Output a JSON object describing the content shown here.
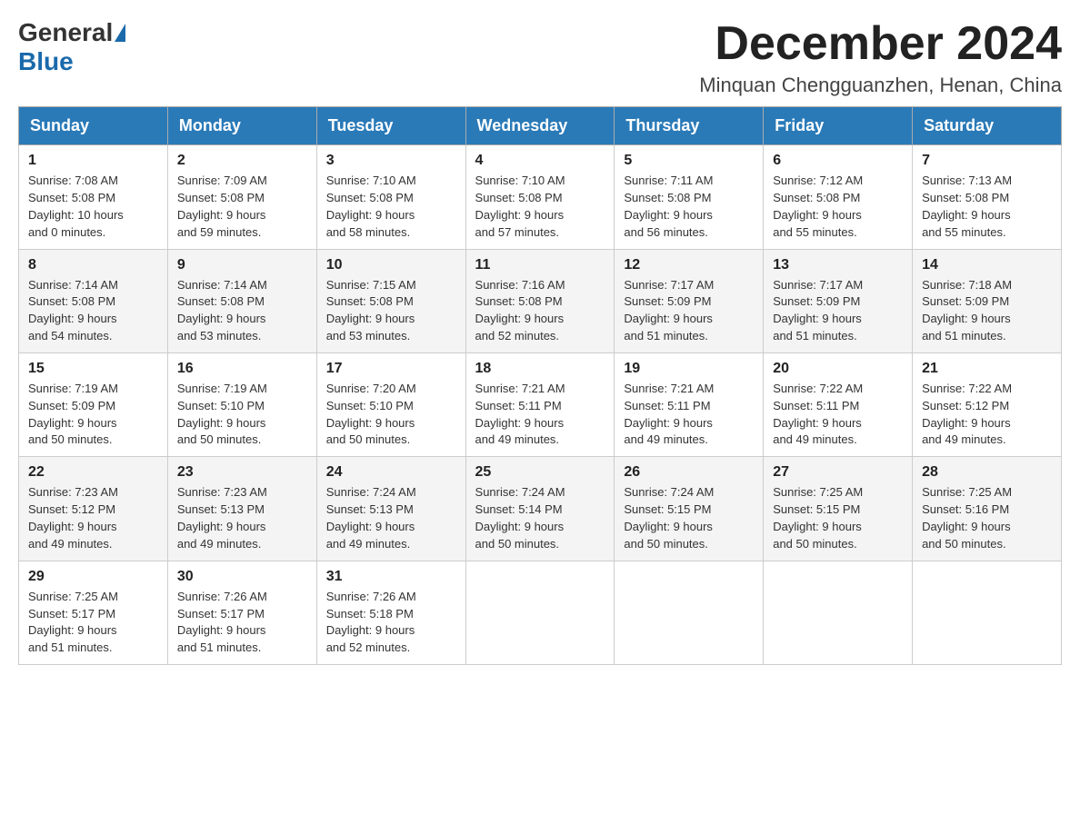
{
  "logo": {
    "general": "General",
    "blue": "Blue"
  },
  "header": {
    "month_year": "December 2024",
    "location": "Minquan Chengguanzhen, Henan, China"
  },
  "weekdays": [
    "Sunday",
    "Monday",
    "Tuesday",
    "Wednesday",
    "Thursday",
    "Friday",
    "Saturday"
  ],
  "weeks": [
    [
      {
        "day": "1",
        "sunrise": "7:08 AM",
        "sunset": "5:08 PM",
        "daylight": "10 hours and 0 minutes."
      },
      {
        "day": "2",
        "sunrise": "7:09 AM",
        "sunset": "5:08 PM",
        "daylight": "9 hours and 59 minutes."
      },
      {
        "day": "3",
        "sunrise": "7:10 AM",
        "sunset": "5:08 PM",
        "daylight": "9 hours and 58 minutes."
      },
      {
        "day": "4",
        "sunrise": "7:10 AM",
        "sunset": "5:08 PM",
        "daylight": "9 hours and 57 minutes."
      },
      {
        "day": "5",
        "sunrise": "7:11 AM",
        "sunset": "5:08 PM",
        "daylight": "9 hours and 56 minutes."
      },
      {
        "day": "6",
        "sunrise": "7:12 AM",
        "sunset": "5:08 PM",
        "daylight": "9 hours and 55 minutes."
      },
      {
        "day": "7",
        "sunrise": "7:13 AM",
        "sunset": "5:08 PM",
        "daylight": "9 hours and 55 minutes."
      }
    ],
    [
      {
        "day": "8",
        "sunrise": "7:14 AM",
        "sunset": "5:08 PM",
        "daylight": "9 hours and 54 minutes."
      },
      {
        "day": "9",
        "sunrise": "7:14 AM",
        "sunset": "5:08 PM",
        "daylight": "9 hours and 53 minutes."
      },
      {
        "day": "10",
        "sunrise": "7:15 AM",
        "sunset": "5:08 PM",
        "daylight": "9 hours and 53 minutes."
      },
      {
        "day": "11",
        "sunrise": "7:16 AM",
        "sunset": "5:08 PM",
        "daylight": "9 hours and 52 minutes."
      },
      {
        "day": "12",
        "sunrise": "7:17 AM",
        "sunset": "5:09 PM",
        "daylight": "9 hours and 51 minutes."
      },
      {
        "day": "13",
        "sunrise": "7:17 AM",
        "sunset": "5:09 PM",
        "daylight": "9 hours and 51 minutes."
      },
      {
        "day": "14",
        "sunrise": "7:18 AM",
        "sunset": "5:09 PM",
        "daylight": "9 hours and 51 minutes."
      }
    ],
    [
      {
        "day": "15",
        "sunrise": "7:19 AM",
        "sunset": "5:09 PM",
        "daylight": "9 hours and 50 minutes."
      },
      {
        "day": "16",
        "sunrise": "7:19 AM",
        "sunset": "5:10 PM",
        "daylight": "9 hours and 50 minutes."
      },
      {
        "day": "17",
        "sunrise": "7:20 AM",
        "sunset": "5:10 PM",
        "daylight": "9 hours and 50 minutes."
      },
      {
        "day": "18",
        "sunrise": "7:21 AM",
        "sunset": "5:11 PM",
        "daylight": "9 hours and 49 minutes."
      },
      {
        "day": "19",
        "sunrise": "7:21 AM",
        "sunset": "5:11 PM",
        "daylight": "9 hours and 49 minutes."
      },
      {
        "day": "20",
        "sunrise": "7:22 AM",
        "sunset": "5:11 PM",
        "daylight": "9 hours and 49 minutes."
      },
      {
        "day": "21",
        "sunrise": "7:22 AM",
        "sunset": "5:12 PM",
        "daylight": "9 hours and 49 minutes."
      }
    ],
    [
      {
        "day": "22",
        "sunrise": "7:23 AM",
        "sunset": "5:12 PM",
        "daylight": "9 hours and 49 minutes."
      },
      {
        "day": "23",
        "sunrise": "7:23 AM",
        "sunset": "5:13 PM",
        "daylight": "9 hours and 49 minutes."
      },
      {
        "day": "24",
        "sunrise": "7:24 AM",
        "sunset": "5:13 PM",
        "daylight": "9 hours and 49 minutes."
      },
      {
        "day": "25",
        "sunrise": "7:24 AM",
        "sunset": "5:14 PM",
        "daylight": "9 hours and 50 minutes."
      },
      {
        "day": "26",
        "sunrise": "7:24 AM",
        "sunset": "5:15 PM",
        "daylight": "9 hours and 50 minutes."
      },
      {
        "day": "27",
        "sunrise": "7:25 AM",
        "sunset": "5:15 PM",
        "daylight": "9 hours and 50 minutes."
      },
      {
        "day": "28",
        "sunrise": "7:25 AM",
        "sunset": "5:16 PM",
        "daylight": "9 hours and 50 minutes."
      }
    ],
    [
      {
        "day": "29",
        "sunrise": "7:25 AM",
        "sunset": "5:17 PM",
        "daylight": "9 hours and 51 minutes."
      },
      {
        "day": "30",
        "sunrise": "7:26 AM",
        "sunset": "5:17 PM",
        "daylight": "9 hours and 51 minutes."
      },
      {
        "day": "31",
        "sunrise": "7:26 AM",
        "sunset": "5:18 PM",
        "daylight": "9 hours and 52 minutes."
      },
      null,
      null,
      null,
      null
    ]
  ],
  "labels": {
    "sunrise": "Sunrise:",
    "sunset": "Sunset:",
    "daylight": "Daylight:"
  }
}
